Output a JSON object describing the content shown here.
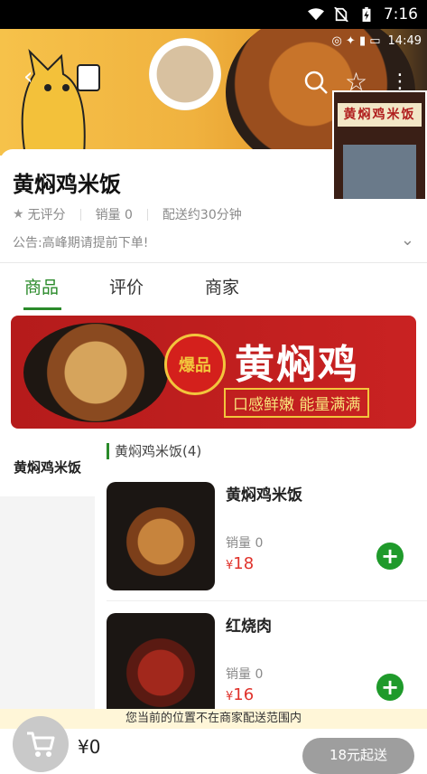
{
  "status_bar": {
    "time": "7:16"
  },
  "hero": {
    "inner_time": "14:49"
  },
  "shop": {
    "name": "黄焖鸡米饭",
    "rating": "无评分",
    "sales": "销量 0",
    "delivery": "配送约30分钟",
    "notice": "公告:高峰期请提前下单!",
    "sign_text": "黄焖鸡米饭"
  },
  "tabs": [
    {
      "label": "商品"
    },
    {
      "label": "评价"
    },
    {
      "label": "商家"
    }
  ],
  "banner": {
    "badge": "爆品",
    "title": "黄焖鸡",
    "slogan": "口感鲜嫩 能量满满"
  },
  "categories": [
    {
      "label": "黄焖鸡米饭"
    }
  ],
  "section": {
    "title": "黄焖鸡米饭(4)"
  },
  "items": [
    {
      "name": "黄焖鸡米饭",
      "sales": "销量 0",
      "price_symbol": "¥",
      "price": "18"
    },
    {
      "name": "红烧肉",
      "sales": "销量 0",
      "price_symbol": "¥",
      "price": "16"
    }
  ],
  "footer": {
    "warning": "您当前的位置不在商家配送范围内",
    "cart_total": "¥0",
    "min_order": "18元起送"
  },
  "colors": {
    "accent": "#2a8a2a",
    "price": "#e0322b",
    "add_button": "#1f9a2b"
  }
}
